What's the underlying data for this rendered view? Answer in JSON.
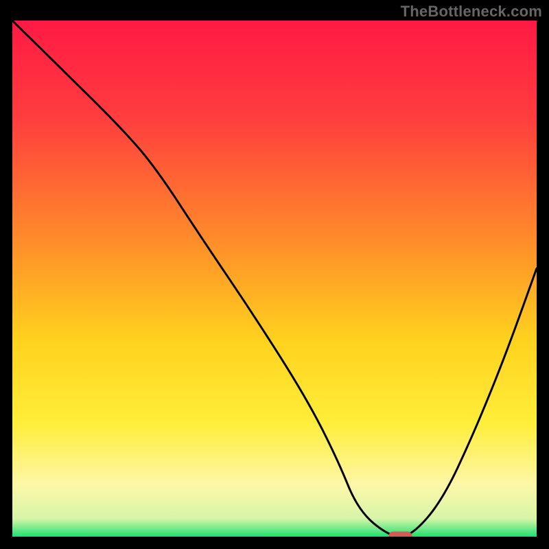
{
  "watermark": "TheBottleneck.com",
  "chart_data": {
    "type": "line",
    "title": "",
    "xlabel": "",
    "ylabel": "",
    "xlim": [
      0,
      100
    ],
    "ylim": [
      0,
      100
    ],
    "grid": false,
    "legend": false,
    "gradient_stops": [
      {
        "offset": 0.0,
        "color": "#ff1a44"
      },
      {
        "offset": 0.19,
        "color": "#ff3e3e"
      },
      {
        "offset": 0.42,
        "color": "#ff8a2a"
      },
      {
        "offset": 0.62,
        "color": "#ffd21e"
      },
      {
        "offset": 0.78,
        "color": "#ffee3a"
      },
      {
        "offset": 0.9,
        "color": "#fdf7a8"
      },
      {
        "offset": 0.965,
        "color": "#d7f5a8"
      },
      {
        "offset": 1.0,
        "color": "#1fdf72"
      }
    ],
    "series": [
      {
        "name": "bottleneck-curve",
        "x": [
          0,
          10,
          20,
          27,
          36,
          46,
          56,
          62,
          66,
          72,
          76,
          82,
          88,
          94,
          100
        ],
        "y": [
          100,
          90,
          80,
          72,
          58,
          43,
          27,
          15,
          5,
          0,
          0,
          7,
          20,
          35,
          52
        ]
      }
    ],
    "optimal_marker": {
      "x": 74,
      "y": 0,
      "w": 4.5,
      "h": 2.0
    }
  }
}
